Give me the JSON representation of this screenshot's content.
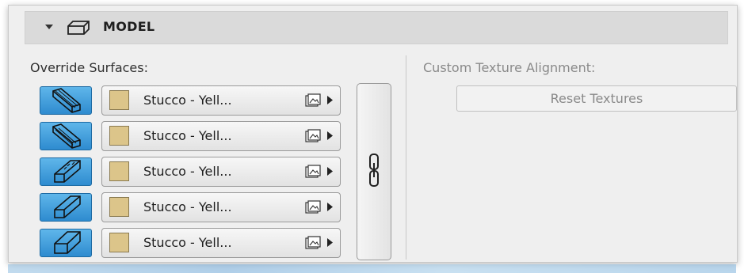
{
  "header": {
    "title": "MODEL",
    "chevron_icon": "chevron-down-icon",
    "model_icon": "model-box-icon"
  },
  "override": {
    "label": "Override Surfaces:",
    "rows": [
      {
        "surface_icon": "surface-top-icon",
        "material": "Stucco - Yell...",
        "swatch_color": "#dcc58a"
      },
      {
        "surface_icon": "surface-bottom-icon",
        "material": "Stucco - Yell...",
        "swatch_color": "#dcc58a"
      },
      {
        "surface_icon": "surface-side-icon",
        "material": "Stucco - Yell...",
        "swatch_color": "#dcc58a"
      },
      {
        "surface_icon": "surface-edge-icon",
        "material": "Stucco - Yell...",
        "swatch_color": "#dcc58a"
      },
      {
        "surface_icon": "surface-end-icon",
        "material": "Stucco - Yell...",
        "swatch_color": "#dcc58a"
      }
    ],
    "link_icon": "chain-link-icon"
  },
  "alignment": {
    "label": "Custom Texture Alignment:",
    "reset_label": "Reset Textures"
  },
  "colors": {
    "accent_blue": "#2e8bcf",
    "swatch": "#dcc58a"
  }
}
